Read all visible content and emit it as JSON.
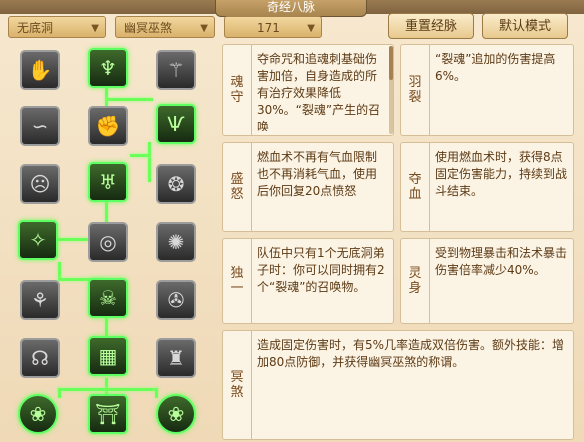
{
  "window": {
    "title": "奇经八脉"
  },
  "filters": {
    "sect": "无底洞",
    "school": "幽冥巫煞",
    "points": "171"
  },
  "buttons": {
    "reset": "重置经脉",
    "default": "默认模式"
  },
  "skills": [
    {
      "name": [
        "魂",
        "守"
      ],
      "desc": "夺命咒和追魂刺基础伤害加倍，自身造成的所有治疗效果降低30%。“裂魂”产生的召唤"
    },
    {
      "name": [
        "盛",
        "怒"
      ],
      "desc": "燃血术不再有气血限制也不再消耗气血，使用后你回复20点愤怒"
    },
    {
      "name": [
        "独",
        "一"
      ],
      "desc": "队伍中只有1个无底洞弟子时：你可以同时拥有2个“裂魂”的召唤物。"
    },
    {
      "name": [
        "冥",
        "煞"
      ],
      "desc": "造成固定伤害时，有5%几率造成双倍伤害。额外技能：增加80点防御，并获得幽冥巫煞的称谓。"
    },
    {
      "name": [
        "羽",
        "裂"
      ],
      "desc": "“裂魂”追加的伤害提高6%。"
    },
    {
      "name": [
        "夺",
        "血"
      ],
      "desc": "使用燃血术时，获得8点固定伤害能力，持续到战斗结束。"
    },
    {
      "name": [
        "灵",
        "身"
      ],
      "desc": "受到物理暴击和法术暴击伤害倍率减少40%。"
    }
  ],
  "icons": [
    "ghost-claw-icon",
    "flame-hand-icon",
    "spirit-wing-icon",
    "serpent-icon",
    "fist-icon",
    "claw-slash-icon",
    "mask-icon",
    "demon-icon",
    "storm-icon",
    "fang-icon",
    "vortex-icon",
    "spiral-icon",
    "shadow-icon",
    "skull-icon",
    "tornado-icon",
    "wraith-icon",
    "talisman-icon",
    "tooth-icon",
    "orb-icon",
    "gate-icon",
    "orb-icon"
  ],
  "colors": {
    "active_border": "#5dff63",
    "path": "#6bff5a"
  }
}
